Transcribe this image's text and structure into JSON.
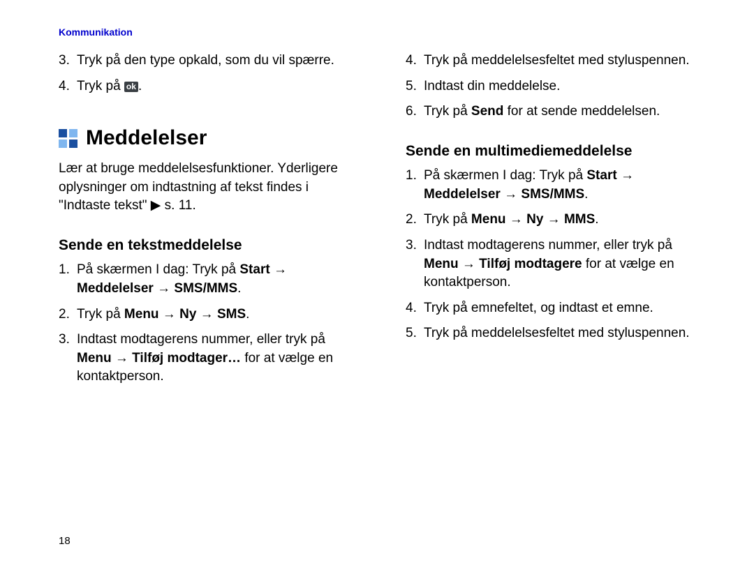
{
  "header": {
    "section": "Kommunikation"
  },
  "page_number": "18",
  "left": {
    "pre_items": [
      {
        "n": "3.",
        "text": "Tryk på den type opkald, som du vil spærre."
      },
      {
        "n": "4.",
        "prefix": "Tryk på ",
        "ok_label": "ok",
        "suffix": "."
      }
    ],
    "h1": "Meddelelser",
    "intro_a": "Lær at bruge meddelelsesfunktioner. Yderligere oplysninger om indtastning af tekst findes i \"Indtaste tekst\" ",
    "intro_arrow": "▶",
    "intro_b": " s. 11.",
    "h2": "Sende en tekstmeddelelse",
    "steps": [
      {
        "n": "1.",
        "segments": [
          {
            "t": "På skærmen I dag: Tryk på "
          },
          {
            "t": "Start",
            "b": true
          },
          {
            "t": " → "
          },
          {
            "t": "Meddelelser",
            "b": true
          },
          {
            "t": " → "
          },
          {
            "t": "SMS/MMS",
            "b": true
          },
          {
            "t": "."
          }
        ]
      },
      {
        "n": "2.",
        "segments": [
          {
            "t": "Tryk på "
          },
          {
            "t": "Menu",
            "b": true
          },
          {
            "t": " → "
          },
          {
            "t": "Ny",
            "b": true
          },
          {
            "t": " → "
          },
          {
            "t": "SMS",
            "b": true
          },
          {
            "t": "."
          }
        ]
      },
      {
        "n": "3.",
        "segments": [
          {
            "t": "Indtast modtagerens nummer, eller tryk på "
          },
          {
            "t": "Menu",
            "b": true
          },
          {
            "t": " → "
          },
          {
            "t": "Tilføj modtager…",
            "b": true
          },
          {
            "t": " for at vælge en kontaktperson."
          }
        ]
      }
    ]
  },
  "right": {
    "pre_items": [
      {
        "n": "4.",
        "text": "Tryk på meddelelsesfeltet med styluspennen."
      },
      {
        "n": "5.",
        "text": "Indtast din meddelelse."
      },
      {
        "n": "6.",
        "segments": [
          {
            "t": "Tryk på "
          },
          {
            "t": "Send",
            "b": true
          },
          {
            "t": " for at sende meddelelsen."
          }
        ]
      }
    ],
    "h2": "Sende en multimediemeddelelse",
    "steps": [
      {
        "n": "1.",
        "segments": [
          {
            "t": "På skærmen I dag: Tryk på "
          },
          {
            "t": "Start",
            "b": true
          },
          {
            "t": " → "
          },
          {
            "t": "Meddelelser",
            "b": true
          },
          {
            "t": " → "
          },
          {
            "t": "SMS/MMS",
            "b": true
          },
          {
            "t": "."
          }
        ]
      },
      {
        "n": "2.",
        "segments": [
          {
            "t": "Tryk på "
          },
          {
            "t": "Menu",
            "b": true
          },
          {
            "t": " → "
          },
          {
            "t": "Ny",
            "b": true
          },
          {
            "t": " → "
          },
          {
            "t": "MMS",
            "b": true
          },
          {
            "t": "."
          }
        ]
      },
      {
        "n": "3.",
        "segments": [
          {
            "t": "Indtast modtagerens nummer, eller tryk på "
          },
          {
            "t": "Menu",
            "b": true
          },
          {
            "t": " → "
          },
          {
            "t": "Tilføj modtagere",
            "b": true
          },
          {
            "t": " for at vælge en kontaktperson."
          }
        ]
      },
      {
        "n": "4.",
        "text": "Tryk på emnefeltet, og indtast et emne."
      },
      {
        "n": "5.",
        "text": "Tryk på meddelelsesfeltet med styluspennen."
      }
    ]
  }
}
